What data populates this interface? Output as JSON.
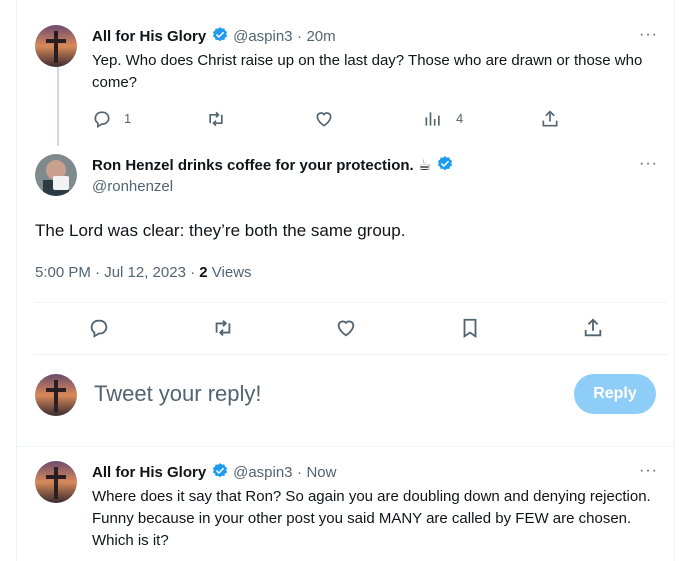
{
  "reply1": {
    "name": "All for His Glory",
    "handle": "@aspin3",
    "time": "20m",
    "text": "Yep.  Who does Christ raise up on the last day?  Those who are drawn or those who come?",
    "reply_count": "1",
    "views": "4"
  },
  "main": {
    "name": "Ron Henzel drinks coffee for your protection. ☕",
    "handle": "@ronhenzel",
    "text": "The Lord was clear: they’re both the same group.",
    "timestamp": "5:00 PM · Jul 12, 2023 · ",
    "views_count": "2",
    "views_label": "Views"
  },
  "composer": {
    "placeholder": "Tweet your reply!",
    "reply_label": "Reply"
  },
  "reply2": {
    "name": "All for His Glory",
    "handle": "@aspin3",
    "time": "Now",
    "text": "Where does it say that Ron?  So again you are doubling down and denying rejection.  Funny because in your other post you said MANY are called by FEW are chosen.  Which is it?"
  },
  "colors": {
    "accent": "#1d9bf0",
    "muted": "#536471",
    "reply_button_disabled": "#8ecdf7"
  },
  "icons": [
    "reply-icon",
    "retweet-icon",
    "like-icon",
    "views-icon",
    "share-icon",
    "bookmark-icon",
    "more-icon",
    "verified-icon"
  ]
}
